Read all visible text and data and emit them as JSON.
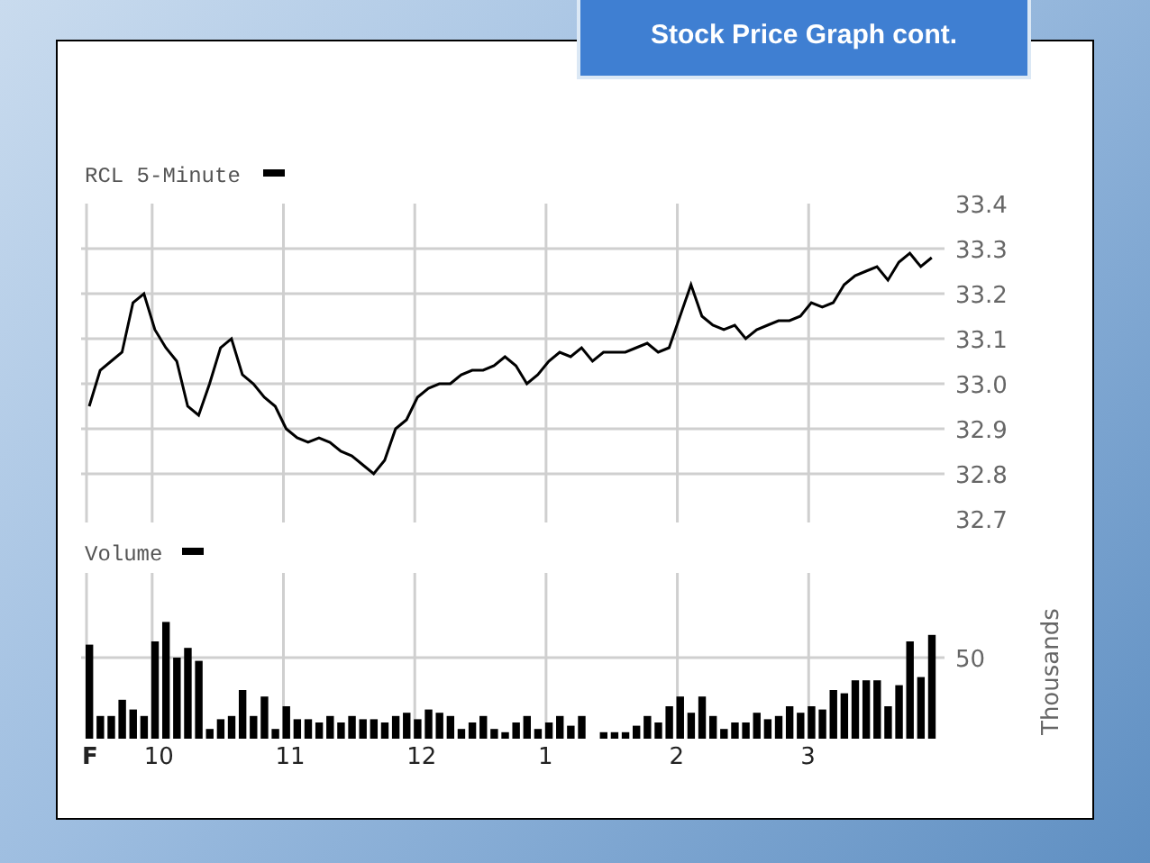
{
  "slide": {
    "title": "Stock Price Graph cont."
  },
  "price_chart": {
    "chart_data": {
      "type": "line",
      "title": "RCL 5-Minute",
      "grid": true,
      "series": [
        {
          "color": "#000000",
          "values": [
            32.95,
            33.03,
            33.05,
            33.07,
            33.18,
            33.2,
            33.12,
            33.08,
            33.05,
            32.95,
            32.93,
            33.0,
            33.08,
            33.1,
            33.02,
            33.0,
            32.97,
            32.95,
            32.9,
            32.88,
            32.87,
            32.88,
            32.87,
            32.85,
            32.84,
            32.82,
            32.8,
            32.83,
            32.9,
            32.92,
            32.97,
            32.99,
            33.0,
            33.0,
            33.02,
            33.03,
            33.03,
            33.04,
            33.06,
            33.04,
            33.0,
            33.02,
            33.05,
            33.07,
            33.06,
            33.08,
            33.05,
            33.07,
            33.07,
            33.07,
            33.08,
            33.09,
            33.07,
            33.08,
            33.15,
            33.22,
            33.15,
            33.13,
            33.12,
            33.13,
            33.1,
            33.12,
            33.13,
            33.14,
            33.14,
            33.15,
            33.18,
            33.17,
            33.18,
            33.22,
            33.24,
            33.25,
            33.26,
            33.23,
            33.27,
            33.29,
            33.26,
            33.28
          ]
        }
      ],
      "ylim": [
        32.7,
        33.4
      ],
      "yticks": [
        {
          "value": 32.7,
          "label": "32.7"
        },
        {
          "value": 32.8,
          "label": "32.8"
        },
        {
          "value": 32.9,
          "label": "32.9"
        },
        {
          "value": 33.0,
          "label": "33.0"
        },
        {
          "value": 33.1,
          "label": "33.1"
        },
        {
          "value": 33.2,
          "label": "33.2"
        },
        {
          "value": 33.3,
          "label": "33.3"
        },
        {
          "value": 33.4,
          "label": "33.4"
        }
      ]
    }
  },
  "volume_chart": {
    "chart_data": {
      "type": "bar",
      "title": "Volume",
      "grid": true,
      "ylabel": "Thousands",
      "categories": [
        "F",
        null,
        null,
        null,
        null,
        null,
        "10",
        null,
        null,
        null,
        null,
        null,
        null,
        null,
        null,
        null,
        null,
        null,
        "11",
        null,
        null,
        null,
        null,
        null,
        null,
        null,
        null,
        null,
        null,
        null,
        "12",
        null,
        null,
        null,
        null,
        null,
        null,
        null,
        null,
        null,
        null,
        null,
        "1",
        null,
        null,
        null,
        null,
        null,
        null,
        null,
        null,
        null,
        null,
        null,
        "2",
        null,
        null,
        null,
        null,
        null,
        null,
        null,
        null,
        null,
        null,
        null,
        "3",
        null,
        null,
        null,
        null,
        null,
        null,
        null,
        null,
        null,
        null,
        null
      ],
      "series": [
        {
          "color": "#000000",
          "values": [
            58,
            14,
            14,
            24,
            18,
            14,
            60,
            72,
            50,
            56,
            48,
            6,
            12,
            14,
            30,
            14,
            26,
            6,
            20,
            12,
            12,
            10,
            14,
            10,
            14,
            12,
            12,
            10,
            14,
            16,
            12,
            18,
            16,
            14,
            6,
            10,
            14,
            6,
            4,
            10,
            14,
            6,
            10,
            14,
            8,
            14,
            0,
            4,
            4,
            4,
            8,
            14,
            10,
            20,
            26,
            16,
            26,
            14,
            6,
            10,
            10,
            16,
            12,
            14,
            20,
            16,
            20,
            18,
            30,
            28,
            36,
            36,
            36,
            20,
            33,
            60,
            38,
            64
          ]
        }
      ],
      "ylim": [
        0,
        75
      ],
      "yticks": [
        {
          "value": 50,
          "label": "50"
        }
      ]
    }
  }
}
